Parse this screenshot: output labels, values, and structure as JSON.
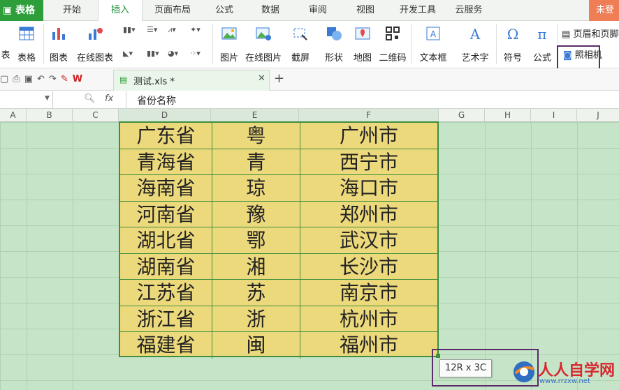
{
  "app": {
    "name": "表格",
    "corner_label": "未登"
  },
  "tabs": [
    "开始",
    "插入",
    "页面布局",
    "公式",
    "数据",
    "审阅",
    "视图",
    "开发工具",
    "云服务"
  ],
  "active_tab": "插入",
  "ribbon": {
    "edge_label_1": "表",
    "table": "表格",
    "chart": "图表",
    "online_chart": "在线图表",
    "picture": "图片",
    "online_picture": "在线图片",
    "screenshot": "截屏",
    "shape": "形状",
    "map": "地图",
    "qrcode": "二维码",
    "textbox": "文本框",
    "wordart": "艺术字",
    "symbol": "符号",
    "formula": "公式",
    "header_footer": "页眉和页脚",
    "camera": "照相机"
  },
  "file_tab": {
    "label": "测试.xls *"
  },
  "formula_bar": {
    "fx": "fx",
    "value": "省份名称"
  },
  "columns": [
    "A",
    "B",
    "C",
    "D",
    "E",
    "F",
    "G",
    "H",
    "I",
    "J"
  ],
  "table_rows": [
    [
      "广东省",
      "粤",
      "广州市"
    ],
    [
      "青海省",
      "青",
      "西宁市"
    ],
    [
      "海南省",
      "琼",
      "海口市"
    ],
    [
      "河南省",
      "豫",
      "郑州市"
    ],
    [
      "湖北省",
      "鄂",
      "武汉市"
    ],
    [
      "湖南省",
      "湘",
      "长沙市"
    ],
    [
      "江苏省",
      "苏",
      "南京市"
    ],
    [
      "浙江省",
      "浙",
      "杭州市"
    ],
    [
      "福建省",
      "闽",
      "福州市"
    ]
  ],
  "selection_tooltip": "12R x 3C",
  "watermark": {
    "text": "人人自学网",
    "url": "www.rrzxw.net"
  },
  "colors": {
    "accent": "#2e9e3a",
    "table_fill": "#ecd97b",
    "table_border": "#3f8f3f",
    "highlight_box": "#5a2a6a"
  }
}
